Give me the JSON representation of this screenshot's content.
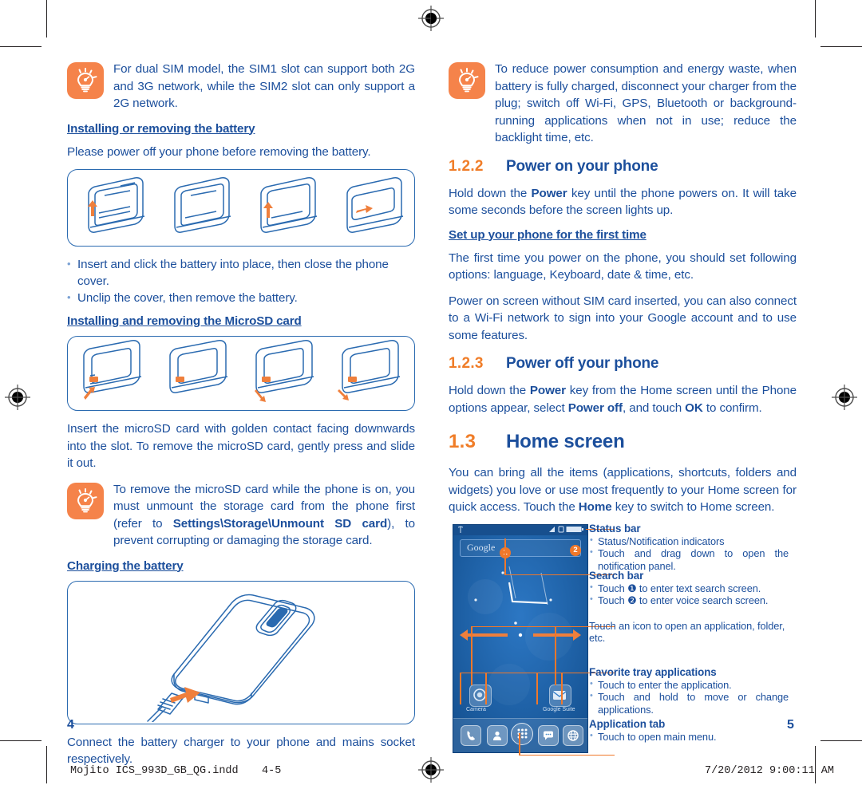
{
  "document": {
    "footer_file": "Mojito ICS_993D_GB_QG.indd",
    "footer_pages": "4-5",
    "footer_timestamp": "7/20/2012   9:00:11 AM",
    "page_number_left": "4",
    "page_number_right": "5"
  },
  "colors": {
    "heading_blue": "#1c4f9c",
    "accent_orange": "#f0782a",
    "tip_icon_bg": "#f5834a",
    "illustration_blue": "#2a6ab0",
    "phone_screen_blue": "#1b5fa8"
  },
  "left_page": {
    "tip_sim": "For dual SIM model, the SIM1 slot can support both 2G and 3G network, while the SIM2 slot can only support a 2G network.",
    "heading_battery": "Installing or removing the battery",
    "battery_intro": "Please power off your phone before removing the battery.",
    "battery_bullets": [
      "Insert and click the battery into place, then close the phone cover.",
      "Unclip the cover, then remove the battery."
    ],
    "heading_microsd": "Installing and removing the MicroSD card",
    "microsd_text": "Insert the microSD card with golden contact facing downwards into the slot. To remove the microSD card, gently press and slide it out.",
    "tip_microsd_pre": "To remove the microSD card while the phone is on, you must unmount the storage card from the phone first (refer to ",
    "tip_microsd_bold": "Settings\\Storage\\Unmount SD card",
    "tip_microsd_post": "), to prevent corrupting or damaging the storage card.",
    "heading_charging": "Charging the battery",
    "charging_text": "Connect the battery charger to your phone and mains socket respectively."
  },
  "right_page": {
    "tip_power": "To reduce power consumption and energy waste, when battery is fully charged, disconnect your charger from the plug; switch off Wi-Fi, GPS, Bluetooth or background-running applications when not in use; reduce the backlight time, etc.",
    "sec_122_num": "1.2.2",
    "sec_122_title": "Power on your phone",
    "power_on_pre": "Hold down the ",
    "power_on_bold": "Power",
    "power_on_post": " key until the phone powers on. It will take some seconds before the screen lights up.",
    "heading_setup": "Set up your phone for the first time",
    "setup_text": "The first time you power on the phone, you should set following options: language, Keyboard, date & time, etc.",
    "setup_text2": "Power on screen without SIM card inserted, you can also connect to a Wi-Fi network to sign into your Google account and to use some features.",
    "sec_123_num": "1.2.3",
    "sec_123_title": "Power off your phone",
    "power_off_1": "Hold down the ",
    "power_off_b1": "Power",
    "power_off_2": " key from the Home screen until the Phone options appear, select ",
    "power_off_b2": "Power off",
    "power_off_3": ", and touch ",
    "power_off_b3": "OK",
    "power_off_4": " to confirm.",
    "sec_13_num": "1.3",
    "sec_13_title": "Home screen",
    "home_text_1": "You can bring all the items (applications, shortcuts, folders and widgets) you love or use most frequently to your Home screen for quick access. Touch the ",
    "home_text_bold": "Home",
    "home_text_2": " key to switch to Home screen."
  },
  "phone_figure": {
    "search_placeholder": "Google",
    "badge_one": "1",
    "badge_two": "2",
    "shortcut_labels": [
      "Camera",
      "Google Suite"
    ],
    "tray_icons": [
      "phone-icon",
      "contacts-icon",
      "app-drawer-icon",
      "messaging-icon",
      "browser-icon"
    ],
    "status_icons": [
      "signal-icon",
      "sim-icon",
      "battery-icon"
    ],
    "callouts": [
      {
        "title": "Status bar",
        "items": [
          "Status/Notification indicators",
          "Touch and drag down to open the notification panel."
        ]
      },
      {
        "title": "Search bar",
        "items": [
          "Touch ❶ to enter text search screen.",
          "Touch ❷ to enter voice search screen."
        ]
      },
      {
        "title": "",
        "plain": "Touch an icon to open an application, folder, etc."
      },
      {
        "title": "Favorite tray applications",
        "items": [
          "Touch to enter the application.",
          "Touch and hold to move or change applications."
        ]
      },
      {
        "title": "Application tab",
        "items": [
          "Touch to open main menu."
        ]
      }
    ]
  }
}
